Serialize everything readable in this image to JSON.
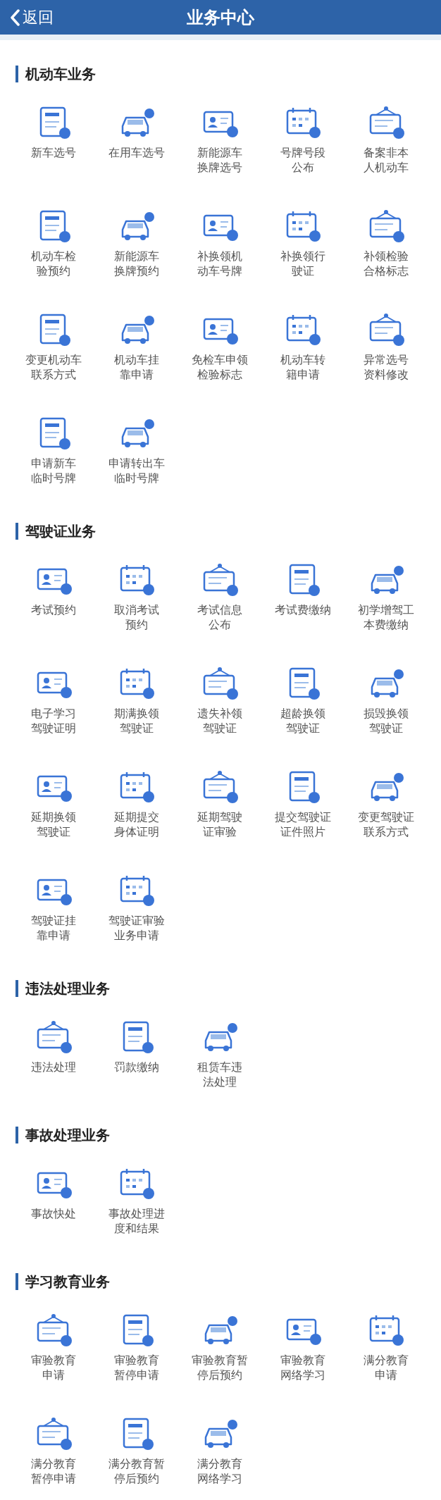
{
  "header": {
    "back": "返回",
    "title": "业务中心"
  },
  "sections": [
    {
      "title": "机动车业务",
      "items": [
        {
          "lines": [
            "新车选号"
          ]
        },
        {
          "lines": [
            "在用车选号"
          ]
        },
        {
          "lines": [
            "新能源车",
            "换牌选号"
          ]
        },
        {
          "lines": [
            "号牌号段",
            "公布"
          ]
        },
        {
          "lines": [
            "备案非本",
            "人机动车"
          ]
        },
        {
          "lines": [
            "机动车检",
            "验预约"
          ]
        },
        {
          "lines": [
            "新能源车",
            "换牌预约"
          ]
        },
        {
          "lines": [
            "补换领机",
            "动车号牌"
          ]
        },
        {
          "lines": [
            "补换领行",
            "驶证"
          ]
        },
        {
          "lines": [
            "补领检验",
            "合格标志"
          ]
        },
        {
          "lines": [
            "变更机动车",
            "联系方式"
          ]
        },
        {
          "lines": [
            "机动车挂",
            "靠申请"
          ]
        },
        {
          "lines": [
            "免检车申领",
            "检验标志"
          ]
        },
        {
          "lines": [
            "机动车转",
            "籍申请"
          ]
        },
        {
          "lines": [
            "异常选号",
            "资料修改"
          ]
        },
        {
          "lines": [
            "申请新车",
            "临时号牌"
          ]
        },
        {
          "lines": [
            "申请转出车",
            "临时号牌"
          ]
        }
      ]
    },
    {
      "title": "驾驶证业务",
      "items": [
        {
          "lines": [
            "考试预约"
          ]
        },
        {
          "lines": [
            "取消考试",
            "预约"
          ]
        },
        {
          "lines": [
            "考试信息",
            "公布"
          ]
        },
        {
          "lines": [
            "考试费缴纳"
          ]
        },
        {
          "lines": [
            "初学增驾工",
            "本费缴纳"
          ]
        },
        {
          "lines": [
            "电子学习",
            "驾驶证明"
          ]
        },
        {
          "lines": [
            "期满换领",
            "驾驶证"
          ]
        },
        {
          "lines": [
            "遗失补领",
            "驾驶证"
          ]
        },
        {
          "lines": [
            "超龄换领",
            "驾驶证"
          ]
        },
        {
          "lines": [
            "损毁换领",
            "驾驶证"
          ]
        },
        {
          "lines": [
            "延期换领",
            "驾驶证"
          ]
        },
        {
          "lines": [
            "延期提交",
            "身体证明"
          ]
        },
        {
          "lines": [
            "延期驾驶",
            "证审验"
          ]
        },
        {
          "lines": [
            "提交驾驶证",
            "证件照片"
          ]
        },
        {
          "lines": [
            "变更驾驶证",
            "联系方式"
          ]
        },
        {
          "lines": [
            "驾驶证挂",
            "靠申请"
          ]
        },
        {
          "lines": [
            "驾驶证审验",
            "业务申请"
          ]
        }
      ]
    },
    {
      "title": "违法处理业务",
      "items": [
        {
          "lines": [
            "违法处理"
          ]
        },
        {
          "lines": [
            "罚款缴纳"
          ]
        },
        {
          "lines": [
            "租赁车违",
            "法处理"
          ]
        }
      ]
    },
    {
      "title": "事故处理业务",
      "items": [
        {
          "lines": [
            "事故快处"
          ]
        },
        {
          "lines": [
            "事故处理进",
            "度和结果"
          ]
        }
      ]
    },
    {
      "title": "学习教育业务",
      "items": [
        {
          "lines": [
            "审验教育",
            "申请"
          ]
        },
        {
          "lines": [
            "审验教育",
            "暂停申请"
          ]
        },
        {
          "lines": [
            "审验教育暂",
            "停后预约"
          ]
        },
        {
          "lines": [
            "审验教育",
            "网络学习"
          ]
        },
        {
          "lines": [
            "满分教育",
            "申请"
          ]
        },
        {
          "lines": [
            "满分教育",
            "暂停申请"
          ]
        },
        {
          "lines": [
            "满分教育暂",
            "停后预约"
          ]
        },
        {
          "lines": [
            "满分教育",
            "网络学习"
          ]
        }
      ]
    }
  ]
}
